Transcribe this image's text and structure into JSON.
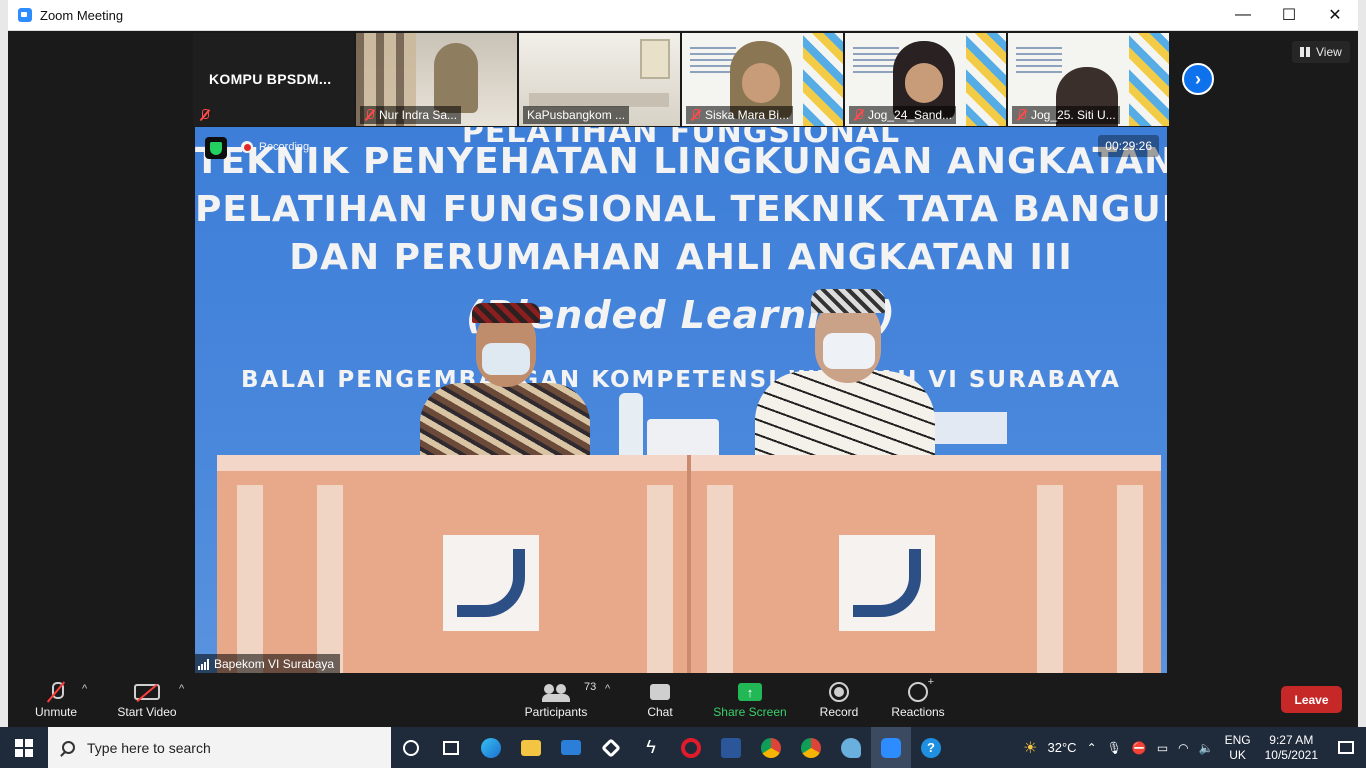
{
  "window": {
    "title": "Zoom Meeting",
    "minimize": "—",
    "maximize": "☐",
    "close": "✕"
  },
  "thumbnails": [
    {
      "label": "KOMPU  BPSDM..."
    },
    {
      "label": "Nur Indra Sa..."
    },
    {
      "label": "KaPusbangkom ..."
    },
    {
      "label": "Siska Mara Bi..."
    },
    {
      "label": "Jog_24_Sand..."
    },
    {
      "label": "Jog_25. Siti U..."
    }
  ],
  "view": {
    "label": "View"
  },
  "main_video": {
    "slide_lines": [
      "PELATIHAN FUNGSIONAL",
      "TEKNIK PENYEHATAN LINGKUNGAN ANGKATAN",
      "PELATIHAN FUNGSIONAL TEKNIK TATA BANGUNAN",
      "DAN PERUMAHAN AHLI ANGKATAN III",
      "(Blended Learning)",
      "BALAI PENGEMBANGAN KOMPETENSI WILAYAH VI SURABAYA"
    ],
    "recording_label": "Recording",
    "timer": "00:29:26",
    "speaker": "Bapekom VI Surabaya"
  },
  "toolbar": {
    "unmute": "Unmute",
    "start_video": "Start Video",
    "participants": "Participants",
    "participants_count": "73",
    "chat": "Chat",
    "share_screen": "Share Screen",
    "record": "Record",
    "reactions": "Reactions",
    "leave": "Leave",
    "caret": "^",
    "share_arrow": "↑"
  },
  "taskbar": {
    "search_placeholder": "Type here to search",
    "weather": "32°C",
    "lang_top": "ENG",
    "lang_bottom": "UK",
    "time": "9:27 AM",
    "date": "10/5/2021"
  },
  "colors": {
    "zoom_blue": "#0e72ed",
    "leave_red": "#c62828",
    "share_green": "#23b856",
    "taskbar": "#1f2a3a"
  }
}
